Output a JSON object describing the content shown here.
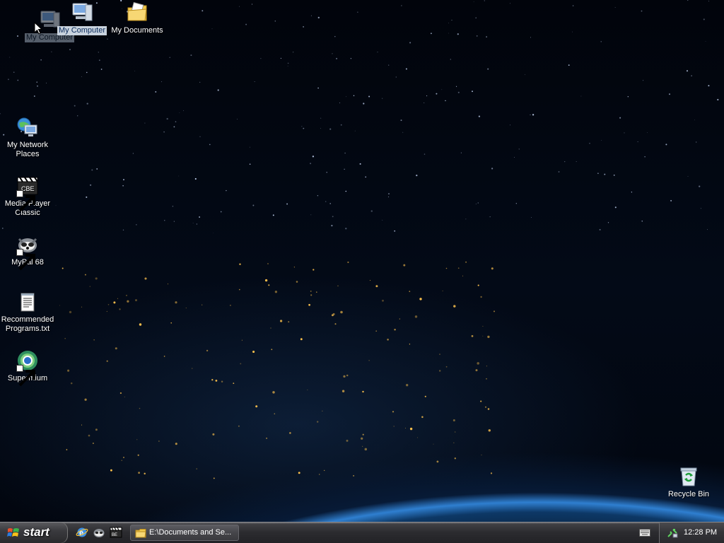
{
  "desktop": {
    "icons": [
      {
        "id": "my-computer-ghost",
        "label": "My Computer",
        "icon": "computer-icon"
      },
      {
        "id": "my-computer",
        "label": "My Computer",
        "icon": "computer-icon"
      },
      {
        "id": "my-documents",
        "label": "My Documents",
        "icon": "folder-documents-icon"
      },
      {
        "id": "my-network-places",
        "label": "My Network Places",
        "icon": "network-places-icon"
      },
      {
        "id": "media-player-classic",
        "label": "Media Player Classic",
        "icon": "media-player-icon"
      },
      {
        "id": "mypal-68",
        "label": "MyPal 68",
        "icon": "mypal-icon"
      },
      {
        "id": "recommended-programs",
        "label": "Recommended Programs.txt",
        "icon": "text-file-icon"
      },
      {
        "id": "supermium",
        "label": "Supermium",
        "icon": "supermium-icon"
      },
      {
        "id": "recycle-bin",
        "label": "Recycle Bin",
        "icon": "recycle-bin-icon"
      }
    ]
  },
  "taskbar": {
    "start_label": "start",
    "quick_launch": [
      {
        "name": "internet-explorer-icon"
      },
      {
        "name": "mypal-icon"
      },
      {
        "name": "media-player-icon"
      }
    ],
    "task_button": {
      "label": "E:\\Documents and Se...",
      "icon": "folder-icon"
    },
    "tray": {
      "clock": "12:28 PM",
      "icons": [
        "keyboard-icon",
        "network-icon"
      ]
    }
  },
  "colors": {
    "taskbar": "#2b2b2f",
    "start_button": "#3a3a3e",
    "icon_text": "#ffffff",
    "selection_highlight": "#c9d3de"
  }
}
